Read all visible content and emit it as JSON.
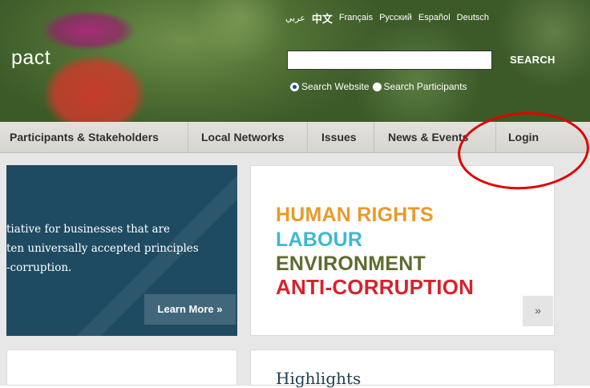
{
  "header": {
    "brand_fragment": "pact",
    "languages": [
      "عربي",
      "中文",
      "Français",
      "Русский",
      "Español",
      "Deutsch"
    ],
    "search": {
      "input_value": "",
      "button_label": "SEARCH",
      "options": [
        {
          "label": "Search Website",
          "selected": true
        },
        {
          "label": "Search Participants",
          "selected": false
        }
      ]
    }
  },
  "nav": {
    "items": [
      "Participants & Stakeholders",
      "Local Networks",
      "Issues",
      "News & Events",
      "Login"
    ]
  },
  "intro": {
    "lines": [
      "tiative for businesses that are",
      "ten universally accepted principles",
      "-corruption."
    ],
    "learn_more_label": "Learn More »"
  },
  "issues_panel": {
    "items": [
      "HUMAN RIGHTS",
      "LABOUR",
      "ENVIRONMENT",
      "ANTI-CORRUPTION"
    ],
    "colors": {
      "human_rights": "#e89a2c",
      "labour": "#3fb7d0",
      "environment": "#5e6b2f",
      "anti_corruption": "#d8222b"
    },
    "next_label": "»"
  },
  "highlights": {
    "title": "Highlights"
  },
  "annotation": {
    "color": "#e00000"
  }
}
